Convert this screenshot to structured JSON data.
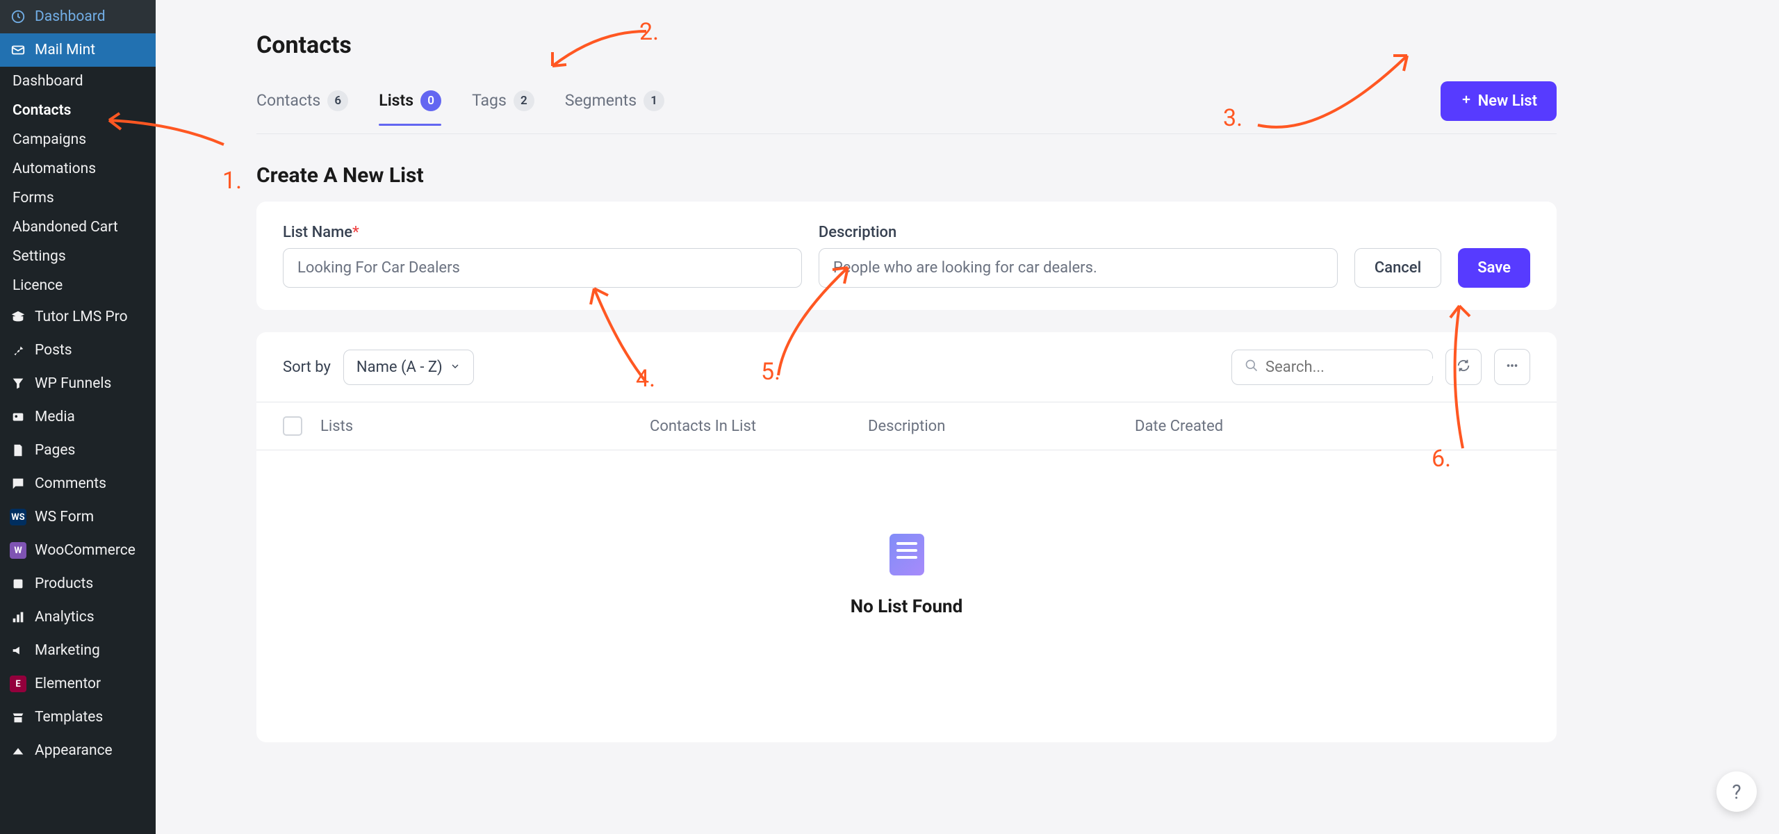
{
  "sidebar": {
    "items": [
      {
        "label": "Dashboard",
        "icon": "dashboard"
      },
      {
        "label": "Mail Mint",
        "icon": "mail",
        "active": true
      },
      {
        "label": "Tutor LMS Pro",
        "icon": "graduation"
      },
      {
        "label": "Posts",
        "icon": "pin"
      },
      {
        "label": "WP Funnels",
        "icon": "funnel"
      },
      {
        "label": "Media",
        "icon": "media"
      },
      {
        "label": "Pages",
        "icon": "page"
      },
      {
        "label": "Comments",
        "icon": "comment"
      },
      {
        "label": "WS Form",
        "icon": "ws"
      },
      {
        "label": "WooCommerce",
        "icon": "woo"
      },
      {
        "label": "Products",
        "icon": "product"
      },
      {
        "label": "Analytics",
        "icon": "analytics"
      },
      {
        "label": "Marketing",
        "icon": "marketing"
      },
      {
        "label": "Elementor",
        "icon": "elementor"
      },
      {
        "label": "Templates",
        "icon": "templates"
      },
      {
        "label": "Appearance",
        "icon": "appearance"
      }
    ],
    "subitems": [
      {
        "label": "Dashboard"
      },
      {
        "label": "Contacts",
        "active": true
      },
      {
        "label": "Campaigns"
      },
      {
        "label": "Automations"
      },
      {
        "label": "Forms"
      },
      {
        "label": "Abandoned Cart"
      },
      {
        "label": "Settings"
      },
      {
        "label": "Licence"
      }
    ]
  },
  "header": {
    "title": "Contacts"
  },
  "tabs": [
    {
      "label": "Contacts",
      "count": "6"
    },
    {
      "label": "Lists",
      "count": "0",
      "active": true
    },
    {
      "label": "Tags",
      "count": "2"
    },
    {
      "label": "Segments",
      "count": "1"
    }
  ],
  "new_list_button": "New List",
  "create_section": {
    "title": "Create A New List",
    "name_label": "List Name",
    "name_value": "Looking For Car Dealers",
    "desc_label": "Description",
    "desc_value": "People who are looking for car dealers.",
    "cancel": "Cancel",
    "save": "Save"
  },
  "table": {
    "sort_label": "Sort by",
    "sort_value": "Name (A - Z)",
    "search_placeholder": "Search...",
    "headers": {
      "lists": "Lists",
      "contacts": "Contacts In List",
      "description": "Description",
      "date": "Date Created"
    },
    "empty": "No List Found"
  },
  "annotations": {
    "a1": "1.",
    "a2": "2.",
    "a3": "3.",
    "a4": "4.",
    "a5": "5.",
    "a6": "6."
  }
}
